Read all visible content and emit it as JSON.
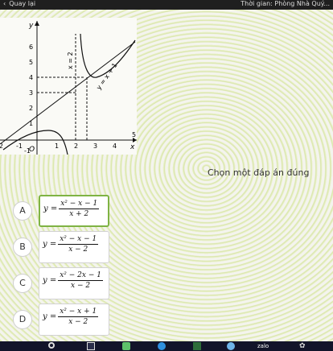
{
  "topbar": {
    "back_label": "Quay lại",
    "back_icon": "chevron-left-icon",
    "timer_text": "Thời gian: Phòng Nhà Quý..."
  },
  "graph": {
    "x_axis_label": "x",
    "y_axis_label": "y",
    "x_ticks": [
      "-2",
      "-1",
      "1",
      "2",
      "3",
      "4",
      "5"
    ],
    "y_ticks": [
      "-1",
      "1",
      "2",
      "3",
      "4",
      "5",
      "6"
    ],
    "origin_label": "O",
    "asymptote_vertical_label": "x = 2",
    "asymptote_oblique_label": "y = x + 1"
  },
  "prompt": "Chọn một đáp án đúng",
  "options": [
    {
      "letter": "A",
      "y": "y =",
      "num": "x² − x − 1",
      "den": "x + 2"
    },
    {
      "letter": "B",
      "y": "y =",
      "num": "x² − x − 1",
      "den": "x − 2"
    },
    {
      "letter": "C",
      "y": "y =",
      "num": "x² − 2x − 1",
      "den": "x − 2"
    },
    {
      "letter": "D",
      "y": "y =",
      "num": "x² − x + 1",
      "den": "x − 2"
    }
  ],
  "selected_option": "A",
  "accent_color": "#7fb344",
  "taskbar": {
    "search_icon": "search-icon",
    "taskview_icon": "task-view-icon",
    "apps": [
      "chat-app-icon",
      "browser-icon",
      "files-icon",
      "chrome-icon",
      "zalo-icon",
      "settings-icon"
    ],
    "app5_label": "zalo"
  }
}
